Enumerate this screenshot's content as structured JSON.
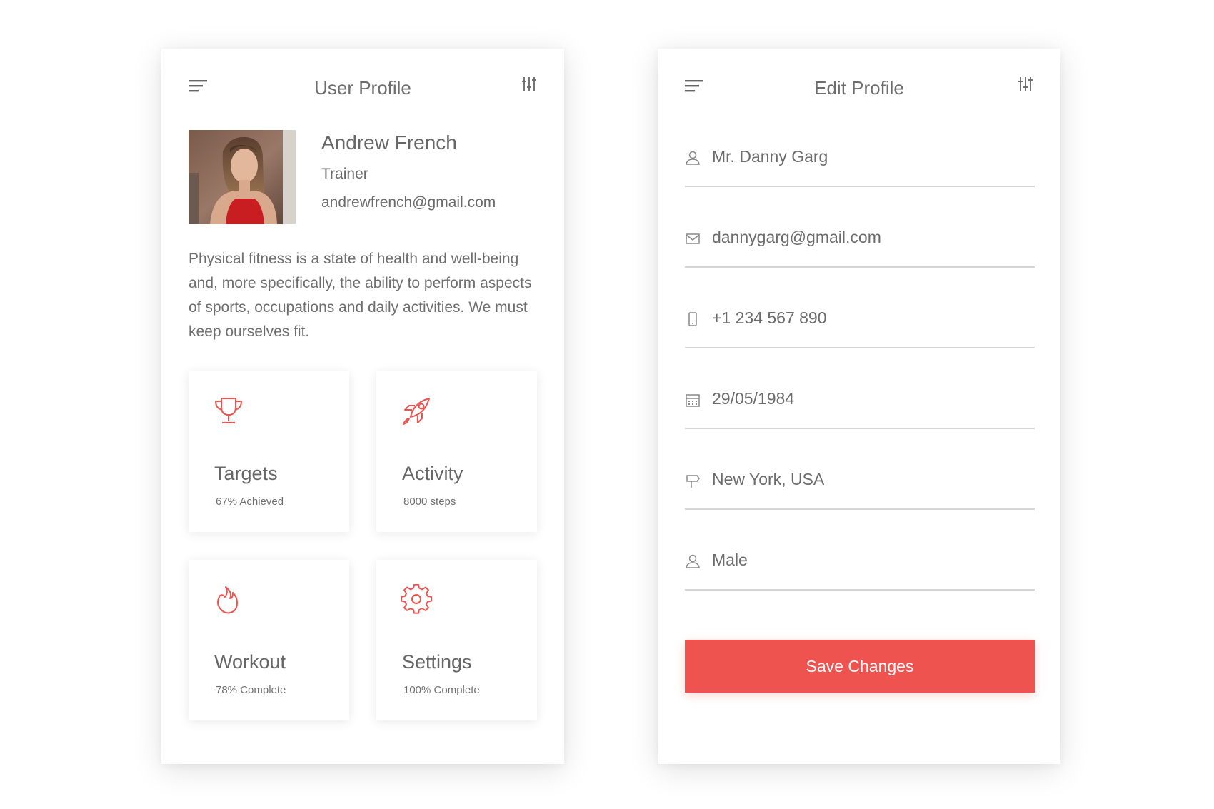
{
  "colors": {
    "accent": "#ef5350",
    "text": "#6b6b6b",
    "divider": "#d6d6d6"
  },
  "profile_screen": {
    "title": "User Profile",
    "name": "Andrew French",
    "role": "Trainer",
    "email": "andrewfrench@gmail.com",
    "bio": "Physical fitness is a state of health and well-being and, more specifically, the ability to perform aspects of sports, occupations and daily activities. We must keep ourselves fit.",
    "tiles": [
      {
        "title": "Targets",
        "subtitle": "67% Achieved",
        "icon": "trophy-icon"
      },
      {
        "title": "Activity",
        "subtitle": "8000 steps",
        "icon": "rocket-icon"
      },
      {
        "title": "Workout",
        "subtitle": "78% Complete",
        "icon": "flame-icon"
      },
      {
        "title": "Settings",
        "subtitle": "100% Complete",
        "icon": "gear-icon"
      }
    ]
  },
  "edit_screen": {
    "title": "Edit Profile",
    "fields": [
      {
        "icon": "user-icon",
        "value": "Mr. Danny Garg"
      },
      {
        "icon": "mail-icon",
        "value": "dannygarg@gmail.com"
      },
      {
        "icon": "phone-icon",
        "value": "+1 234 567 890"
      },
      {
        "icon": "calendar-icon",
        "value": "29/05/1984"
      },
      {
        "icon": "signpost-icon",
        "value": "New York, USA"
      },
      {
        "icon": "user-icon",
        "value": "Male"
      }
    ],
    "save_label": "Save Changes"
  }
}
